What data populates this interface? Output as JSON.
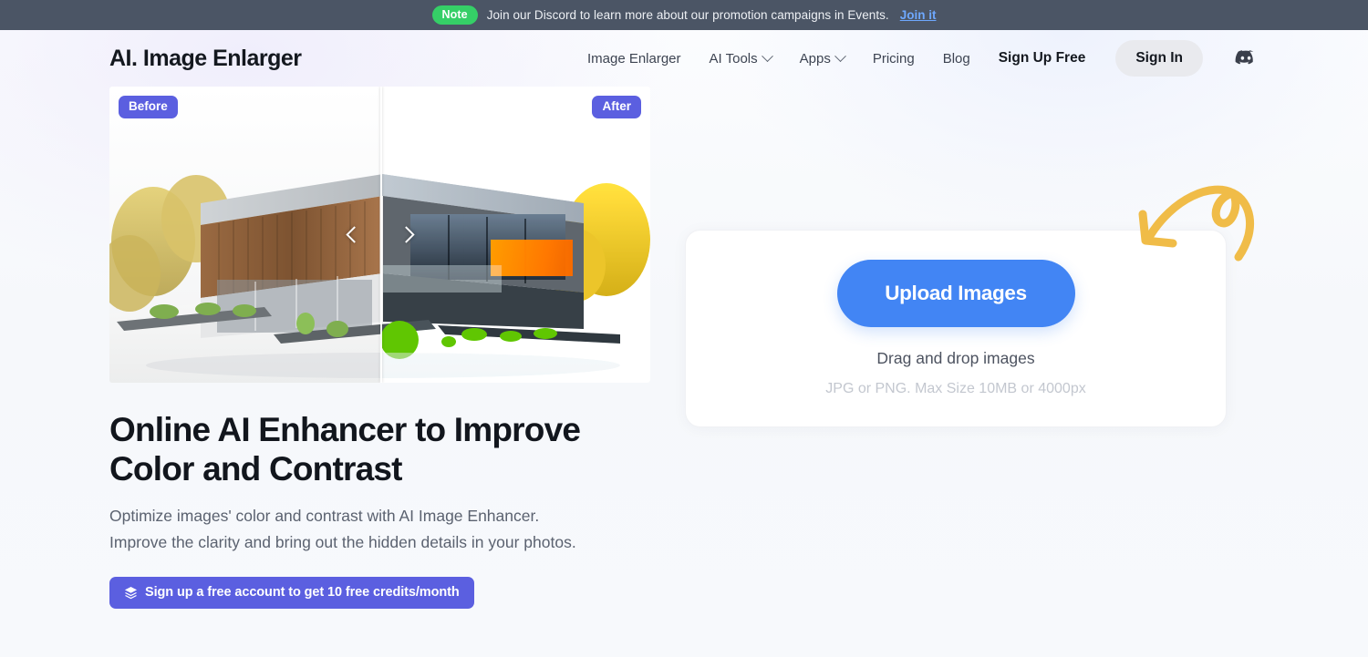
{
  "banner": {
    "badge": "Note",
    "text": "Join our Discord to learn more about our promotion campaigns in Events.",
    "link_label": "Join it",
    "bg_color": "#4b5565",
    "badge_color": "#35cf67",
    "link_color": "#6ea8fe"
  },
  "header": {
    "logo": "AI. Image Enlarger",
    "nav": [
      {
        "label": "Image Enlarger",
        "has_caret": false
      },
      {
        "label": "AI Tools",
        "has_caret": true
      },
      {
        "label": "Apps",
        "has_caret": true
      },
      {
        "label": "Pricing",
        "has_caret": false
      },
      {
        "label": "Blog",
        "has_caret": false
      }
    ],
    "signup_label": "Sign Up Free",
    "signin_label": "Sign In",
    "discord_icon": "discord-icon"
  },
  "hero": {
    "before_label": "Before",
    "after_label": "After",
    "title": "Online AI Enhancer to Improve Color and Contrast",
    "subtitle_line1": "Optimize images' color and contrast with AI Image Enhancer.",
    "subtitle_line2": "Improve the clarity and bring out the hidden details in your photos.",
    "credits_button": "Sign up a free account to get 10 free credits/month",
    "credits_icon": "layers-icon",
    "badge_color": "#5b5fe0",
    "slider_left_icon": "chevron-left-icon",
    "slider_right_icon": "chevron-right-icon"
  },
  "upload": {
    "button_label": "Upload Images",
    "drag_text": "Drag and drop images",
    "hint_text": "JPG or PNG. Max Size 10MB or 4000px",
    "button_color": "#4285f4",
    "arrow_icon": "curved-arrow-icon",
    "arrow_color": "#f0bc48"
  }
}
